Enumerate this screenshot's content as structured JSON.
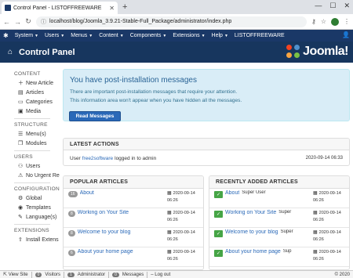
{
  "browser": {
    "tab_title": "Control Panel - LISTOFFREEWARE",
    "url": "localhost/blog/Joomla_3.9.21-Stable-Full_Package/administrator/index.php"
  },
  "topnav": {
    "items": [
      "System",
      "Users",
      "Menus",
      "Content",
      "Components",
      "Extensions",
      "Help"
    ],
    "site_name": "LISTOFFREEWARE"
  },
  "header": {
    "title": "Control Panel",
    "brand": "Joomla!"
  },
  "sidebar": {
    "content_title": "CONTENT",
    "content_items": [
      "New Article",
      "Articles",
      "Categories",
      "Media"
    ],
    "structure_title": "STRUCTURE",
    "structure_items": [
      "Menu(s)",
      "Modules"
    ],
    "users_title": "USERS",
    "users_items": [
      "Users",
      "No Urgent Re"
    ],
    "config_title": "CONFIGURATION",
    "config_items": [
      "Global",
      "Templates",
      "Language(s)"
    ],
    "ext_title": "EXTENSIONS",
    "ext_items": [
      "Install Extens"
    ]
  },
  "message": {
    "heading": "You have post-installation messages",
    "line1": "There are important post-installation messages that require your attention.",
    "line2": "This information area won't appear when you have hidden all the messages.",
    "button": "Read Messages"
  },
  "latest_actions": {
    "title": "LATEST ACTIONS",
    "user_prefix": "User ",
    "user": "free2software",
    "action": " logged in to admin",
    "date": "2020-09-14 06:33"
  },
  "popular": {
    "title": "POPULAR ARTICLES",
    "rows": [
      {
        "hits": "16",
        "title": "About",
        "date1": "2020-09-14",
        "date2": "06:26"
      },
      {
        "hits": "8",
        "title": "Working on Your Site",
        "date1": "2020-09-14",
        "date2": "06:26"
      },
      {
        "hits": "8",
        "title": "Welcome to your blog",
        "date1": "2020-09-14",
        "date2": "06:26"
      },
      {
        "hits": "6",
        "title": "About your home page",
        "date1": "2020-09-14",
        "date2": "06:26"
      }
    ]
  },
  "recent": {
    "title": "RECENTLY ADDED ARTICLES",
    "rows": [
      {
        "title": "About",
        "by": " Super User",
        "date1": "2020-09-14",
        "date2": "06:26"
      },
      {
        "title": "Working on Your Site",
        "by": " Super",
        "date1": "2020-09-14",
        "date2": "06:26"
      },
      {
        "title": "Welcome to your blog",
        "by": " Super",
        "date1": "2020-09-14",
        "date2": "06:26"
      },
      {
        "title": "About your home page",
        "by": " Sup",
        "date1": "2020-09-14",
        "date2": "06:26"
      }
    ]
  },
  "status": {
    "view_site": "View Site",
    "visitors_count": "0",
    "visitors": "Visitors",
    "admin_count": "1",
    "admin": "Administrator",
    "messages_count": "0",
    "messages": "Messages",
    "logout": "Log out",
    "copyright": "© 2020"
  },
  "colors": {
    "nav_bg": "#1a3867",
    "header_bg": "#17365e",
    "link": "#2a69b8",
    "message_bg": "#d9edf7",
    "success": "#46a546"
  }
}
